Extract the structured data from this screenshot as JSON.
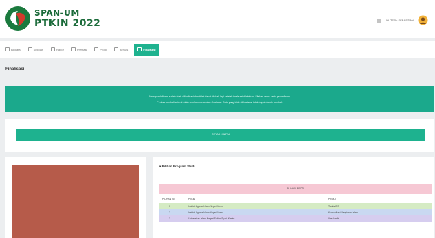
{
  "brand": {
    "line1": "SPAN-UM",
    "line2": "PTKIN 2022"
  },
  "user": {
    "name": "NUTERA SEBASTIAN"
  },
  "nav": {
    "items": [
      {
        "label": "Biodata"
      },
      {
        "label": "Sekolah"
      },
      {
        "label": "Rapor"
      },
      {
        "label": "Prestasi"
      },
      {
        "label": "Prodi"
      },
      {
        "label": "Berkas"
      },
      {
        "label": "Finalisasi",
        "active": true
      }
    ]
  },
  "page": {
    "title": "Finalisasi"
  },
  "banner": {
    "line1": "Data pendaftaran sudah tidak difinalisasi dan tidak dapat diubah lagi setelah finalisasi dilakukan. Silakan cetak kartu pendaftaran.",
    "line2": "Periksa kembali seluruh data sebelum melakukan finalisasi. Data yang telah difinalisasi tidak dapat diubah kembali."
  },
  "actions": {
    "main_label": "CETAK KARTU"
  },
  "prodi": {
    "title": "Pilihan Program Studi",
    "table_title": "PILIHAN PRODI",
    "columns": [
      "PILIHAN KE",
      "PTKIN",
      "PRODI"
    ],
    "rows": [
      {
        "no": "1",
        "ptkin": "Institut Agama Islam Negeri Metro",
        "prodi": "Tadris IPS"
      },
      {
        "no": "2",
        "ptkin": "Institut Agama Islam Negeri Metro",
        "prodi": "Komunikasi Penyiaran Islam"
      },
      {
        "no": "3",
        "ptkin": "Universitas Islam Negeri Sultan Syarif Kasim",
        "prodi": "Ilmu Hadis"
      }
    ]
  },
  "colors": {
    "accent": "#1eb28f",
    "banner": "#1ba98c",
    "brand": "#1b6b3a",
    "photo": "#b65b4a"
  }
}
